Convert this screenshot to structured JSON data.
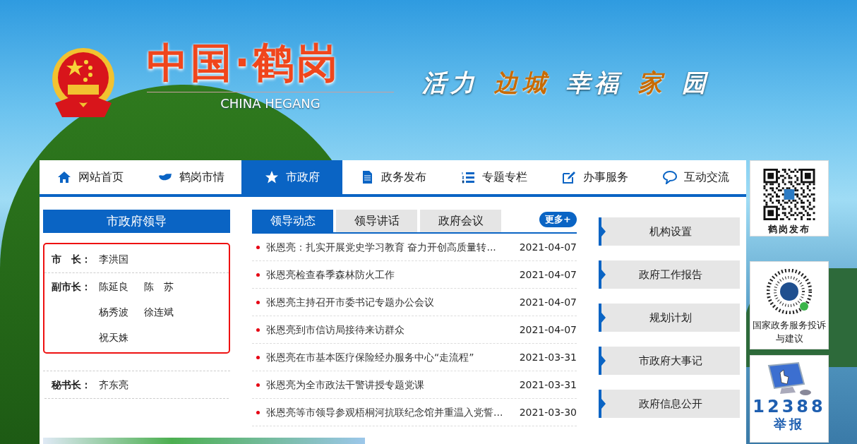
{
  "header": {
    "title": "中国·鹤岗",
    "subtitle": "CHINA HEGANG",
    "slogan": [
      {
        "text": "活力",
        "highlight": false
      },
      {
        "text": "边城",
        "highlight": true
      },
      {
        "text": "幸福",
        "highlight": false
      },
      {
        "text": "家",
        "highlight": true
      },
      {
        "text": "园",
        "highlight": false
      }
    ]
  },
  "nav": [
    {
      "label": "网站首页",
      "selected": false
    },
    {
      "label": "鹤岗市情",
      "selected": false
    },
    {
      "label": "市政府",
      "selected": true
    },
    {
      "label": "政务发布",
      "selected": false
    },
    {
      "label": "专题专栏",
      "selected": false
    },
    {
      "label": "办事服务",
      "selected": false
    },
    {
      "label": "互动交流",
      "selected": false
    }
  ],
  "leaders": {
    "title": "市政府领导",
    "groups": [
      {
        "outlined": true,
        "rows": [
          {
            "role": "市　长：",
            "names": [
              "李洪国"
            ]
          },
          {
            "role": "副市长：",
            "names": [
              "陈延良",
              "陈　苏",
              "杨秀波",
              "徐连斌",
              "祝天姝"
            ]
          }
        ]
      },
      {
        "outlined": false,
        "rows": [
          {
            "role": "秘书长：",
            "names": [
              "齐东亮"
            ]
          }
        ]
      }
    ]
  },
  "news": {
    "tabs": [
      {
        "label": "领导动态",
        "selected": true
      },
      {
        "label": "领导讲话",
        "selected": false
      },
      {
        "label": "政府会议",
        "selected": false
      }
    ],
    "more": "更多+",
    "items": [
      {
        "title": "张恩亮：扎实开展党史学习教育 奋力开创高质量转...",
        "date": "2021-04-07"
      },
      {
        "title": "张恩亮检查春季森林防火工作",
        "date": "2021-04-07"
      },
      {
        "title": "张恩亮主持召开市委书记专题办公会议",
        "date": "2021-04-07"
      },
      {
        "title": "张恩亮到市信访局接待来访群众",
        "date": "2021-04-07"
      },
      {
        "title": "张恩亮在市基本医疗保险经办服务中心“走流程”",
        "date": "2021-03-31"
      },
      {
        "title": "张恩亮为全市政法干警讲授专题党课",
        "date": "2021-03-31"
      },
      {
        "title": "张恩亮等市领导参观梧桐河抗联纪念馆并重温入党誓...",
        "date": "2021-03-30"
      }
    ]
  },
  "links": [
    "机构设置",
    "政府工作报告",
    "规划计划",
    "市政府大事记",
    "政府信息公开"
  ],
  "side_cards": [
    {
      "kind": "qr",
      "caption": "鹤岗发布"
    },
    {
      "kind": "miniprogram",
      "caption": "国家政务服务投诉与建议"
    },
    {
      "kind": "report",
      "number": "12388",
      "caption": "举报"
    }
  ]
}
